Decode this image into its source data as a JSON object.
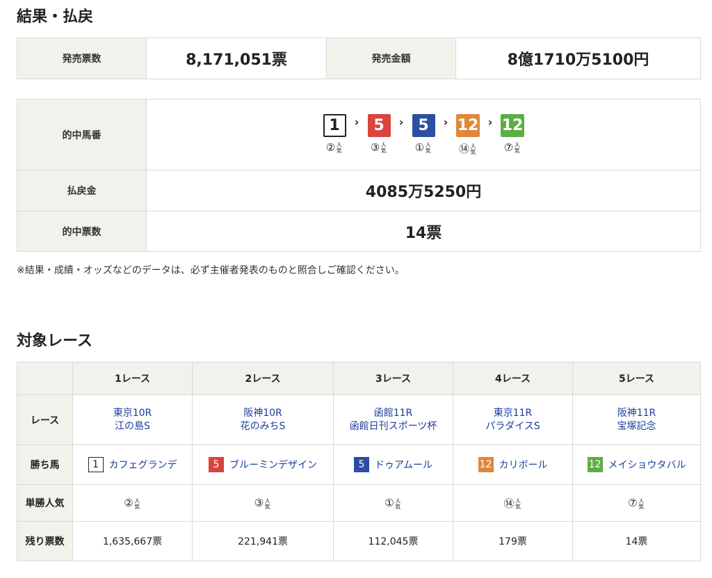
{
  "result_heading": "結果・払戻",
  "sales": {
    "count_label": "発売票数",
    "count_value": "8,171,051票",
    "amount_label": "発売金額",
    "amount_value": "8億1710万5100円"
  },
  "hit": {
    "numbers_label": "的中馬番",
    "numbers": [
      {
        "num": "1",
        "color": "white",
        "pop": "②"
      },
      {
        "num": "5",
        "color": "red",
        "pop": "③"
      },
      {
        "num": "5",
        "color": "blue",
        "pop": "①"
      },
      {
        "num": "12",
        "color": "orange",
        "pop": "⑭"
      },
      {
        "num": "12",
        "color": "green",
        "pop": "⑦"
      }
    ],
    "arrow": "›",
    "pop_suffix": "人気",
    "payout_label": "払戻金",
    "payout_value": "4085万5250円",
    "tickets_label": "的中票数",
    "tickets_value": "14票"
  },
  "note": "※結果・成績・オッズなどのデータは、必ず主催者発表のものと照合しご確認ください。",
  "target_heading": "対象レース",
  "races": {
    "headers": [
      "1レース",
      "2レース",
      "3レース",
      "4レース",
      "5レース"
    ],
    "row_labels": {
      "race": "レース",
      "winner": "勝ち馬",
      "pop": "単勝人気",
      "remain": "残り票数"
    },
    "items": [
      {
        "venue": "東京10R",
        "name": "江の島S",
        "num": "1",
        "color": "white",
        "horse": "カフェグランデ",
        "pop": "②",
        "remain": "1,635,667票"
      },
      {
        "venue": "阪神10R",
        "name": "花のみちS",
        "num": "5",
        "color": "red",
        "horse": "ブルーミンデザイン",
        "pop": "③",
        "remain": "221,941票"
      },
      {
        "venue": "函館11R",
        "name": "函館日刊スポーツ杯",
        "num": "5",
        "color": "blue",
        "horse": "ドゥアムール",
        "pop": "①",
        "remain": "112,045票"
      },
      {
        "venue": "東京11R",
        "name": "パラダイスS",
        "num": "12",
        "color": "orange",
        "horse": "カリボール",
        "pop": "⑭",
        "remain": "179票"
      },
      {
        "venue": "阪神11R",
        "name": "宝塚記念",
        "num": "12",
        "color": "green",
        "horse": "メイショウタバル",
        "pop": "⑦",
        "remain": "14票"
      }
    ]
  }
}
